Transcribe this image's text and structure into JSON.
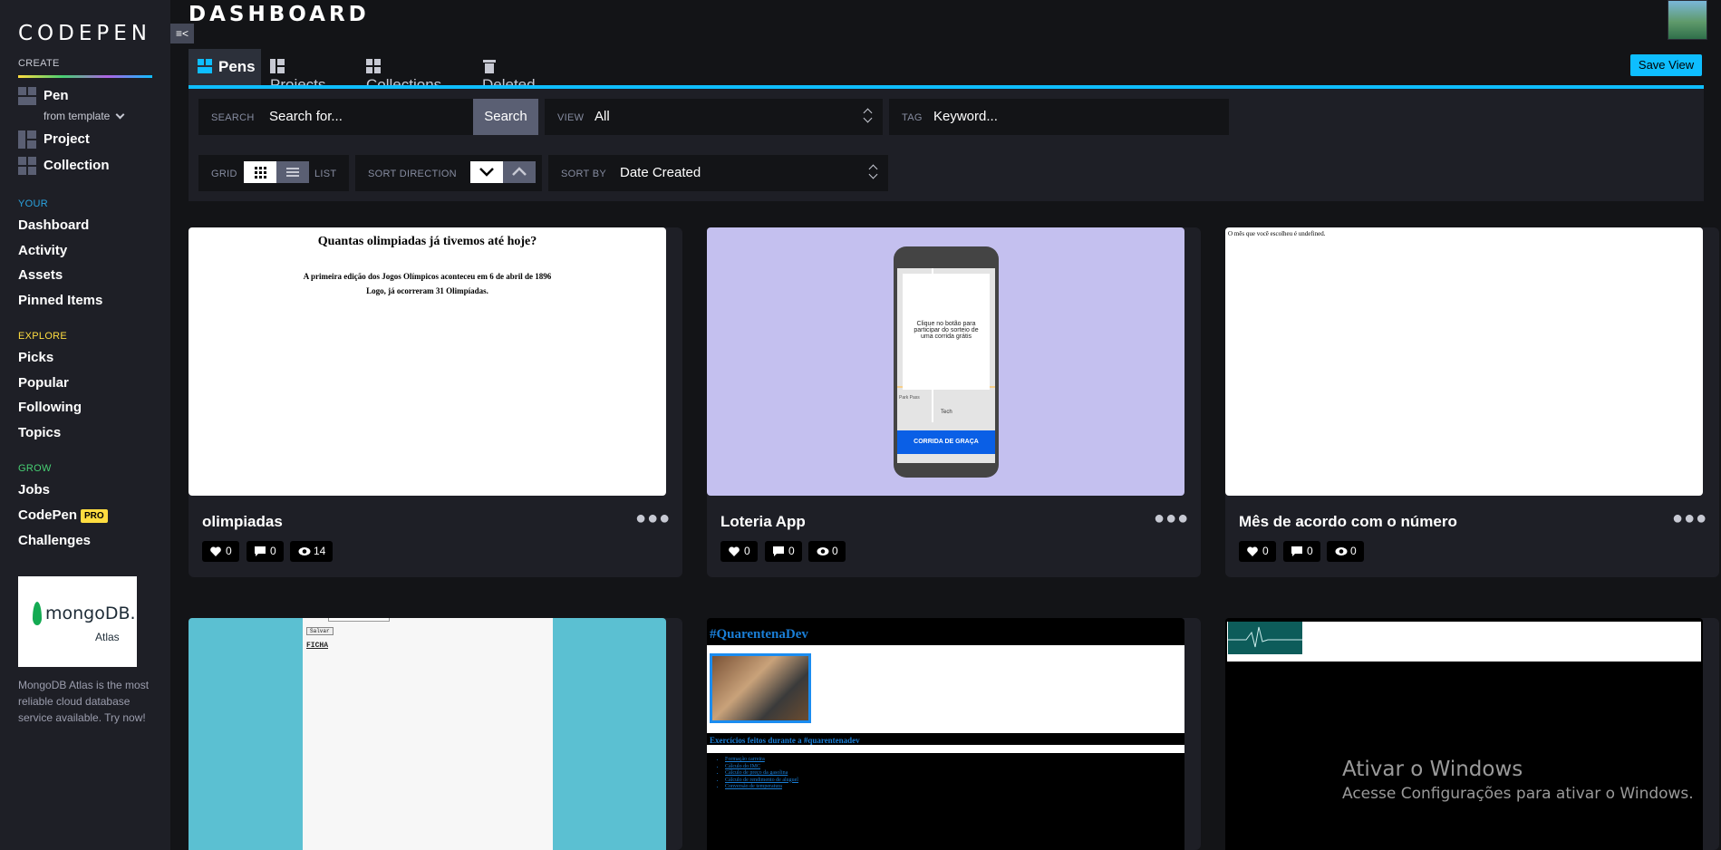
{
  "app": {
    "logo": "CODEPEN",
    "page_title": "DASHBOARD"
  },
  "sidebar": {
    "create_label": "CREATE",
    "pen": "Pen",
    "from_template": "from template",
    "project": "Project",
    "collection": "Collection",
    "your_label": "YOUR",
    "your_items": [
      "Dashboard",
      "Activity",
      "Assets",
      "Pinned Items"
    ],
    "explore_label": "EXPLORE",
    "explore_items": [
      "Picks",
      "Popular",
      "Following",
      "Topics"
    ],
    "grow_label": "GROW",
    "jobs": "Jobs",
    "codepen": "CodePen",
    "pro": "PRO",
    "challenges": "Challenges",
    "ad": {
      "brand": "mongoDB.",
      "sub": "Atlas",
      "text": "MongoDB Atlas is the most reliable cloud database service available. Try now!"
    }
  },
  "tabs": [
    "Pens",
    "Projects",
    "Collections",
    "Deleted"
  ],
  "save_view": "Save View",
  "filters": {
    "search_label": "SEARCH",
    "search_placeholder": "Search for...",
    "search_button": "Search",
    "view_label": "VIEW",
    "view_value": "All",
    "tag_label": "TAG",
    "tag_placeholder": "Keyword...",
    "grid_label": "GRID",
    "list_label": "LIST",
    "sort_direction_label": "SORT DIRECTION",
    "sort_by_label": "SORT BY",
    "sort_by_value": "Date Created"
  },
  "pens": [
    {
      "title": "olimpiadas",
      "likes": "0",
      "comments": "0",
      "views": "14",
      "preview": {
        "heading": "Quantas olimpiadas já tivemos até hoje?",
        "line1": "A primeira edição dos Jogos Olímpicos aconteceu em 6 de abril de 1896",
        "line2": "Logo, já ocorreram 31 Olimpíadas."
      }
    },
    {
      "title": "Loteria App",
      "likes": "0",
      "comments": "0",
      "views": "0",
      "preview": {
        "text": "Clique no botão para participar do sorteio de uma corrida grátis",
        "button": "CORRIDA DE GRAÇA",
        "map1": "Park Pass",
        "map2": "Tech"
      }
    },
    {
      "title": "Mês de acordo com o número",
      "likes": "0",
      "comments": "0",
      "views": "0",
      "preview": {
        "text": "O mês que você escolheu é undefined."
      }
    },
    {
      "title": "",
      "preview": {
        "button": "Salvar",
        "label": "FICHA"
      }
    },
    {
      "title": "",
      "preview": {
        "heading": "#QuarentenaDev",
        "subheading": "Exercícios feitos durante a #quarentenadev",
        "links": [
          "Formação carreira",
          "Cálculo do IMC",
          "Cálculo de preço da gasolina",
          "Cálculo de rendimento de aluguel",
          "Conversão de temperatura"
        ]
      }
    },
    {
      "title": "",
      "preview": {}
    }
  ],
  "windows_notice": {
    "title": "Ativar o Windows",
    "subtitle": "Acesse Configurações para ativar o Windows."
  }
}
